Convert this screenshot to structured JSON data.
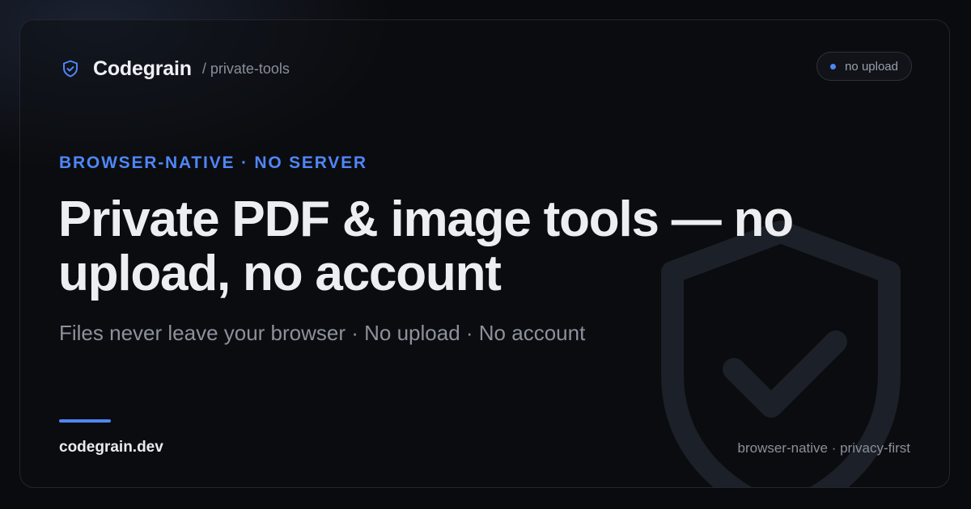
{
  "brand": {
    "icon": "shield-check-icon",
    "name": "Codegrain",
    "path": "/ private-tools"
  },
  "badge": {
    "label": "no upload",
    "dot_color": "#4f86f7"
  },
  "hero": {
    "eyebrow": "BROWSER-NATIVE · NO SERVER",
    "title": "Private PDF & image tools — no upload, no account",
    "subtitle": "Files never leave your browser · No upload · No account"
  },
  "footer": {
    "domain": "codegrain.dev",
    "tagline": "browser-native · privacy-first"
  },
  "decor": {
    "watermark_icon": "shield-check-icon"
  },
  "colors": {
    "accent": "#4f86f7",
    "background": "#0a0b0e",
    "text_primary": "#eceef2",
    "text_muted": "#8c919b"
  }
}
